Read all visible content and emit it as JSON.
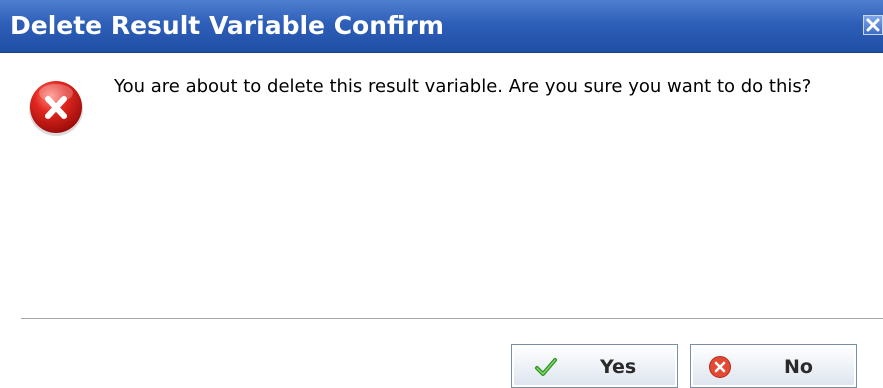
{
  "dialog": {
    "title": "Delete Result Variable Confirm",
    "close_icon": "close-icon",
    "status_icon": "error-icon",
    "message": "You are about to delete this result variable. Are you sure you want to do this?"
  },
  "buttons": {
    "yes_label": "Yes",
    "yes_icon": "checkmark-icon",
    "no_label": "No",
    "no_icon": "cancel-icon"
  },
  "colors": {
    "titlebar": "#2e5fb8",
    "title_text": "#ffffff",
    "error_red": "#d4201c",
    "check_green": "#3aa12c",
    "cancel_red": "#e0503a"
  }
}
